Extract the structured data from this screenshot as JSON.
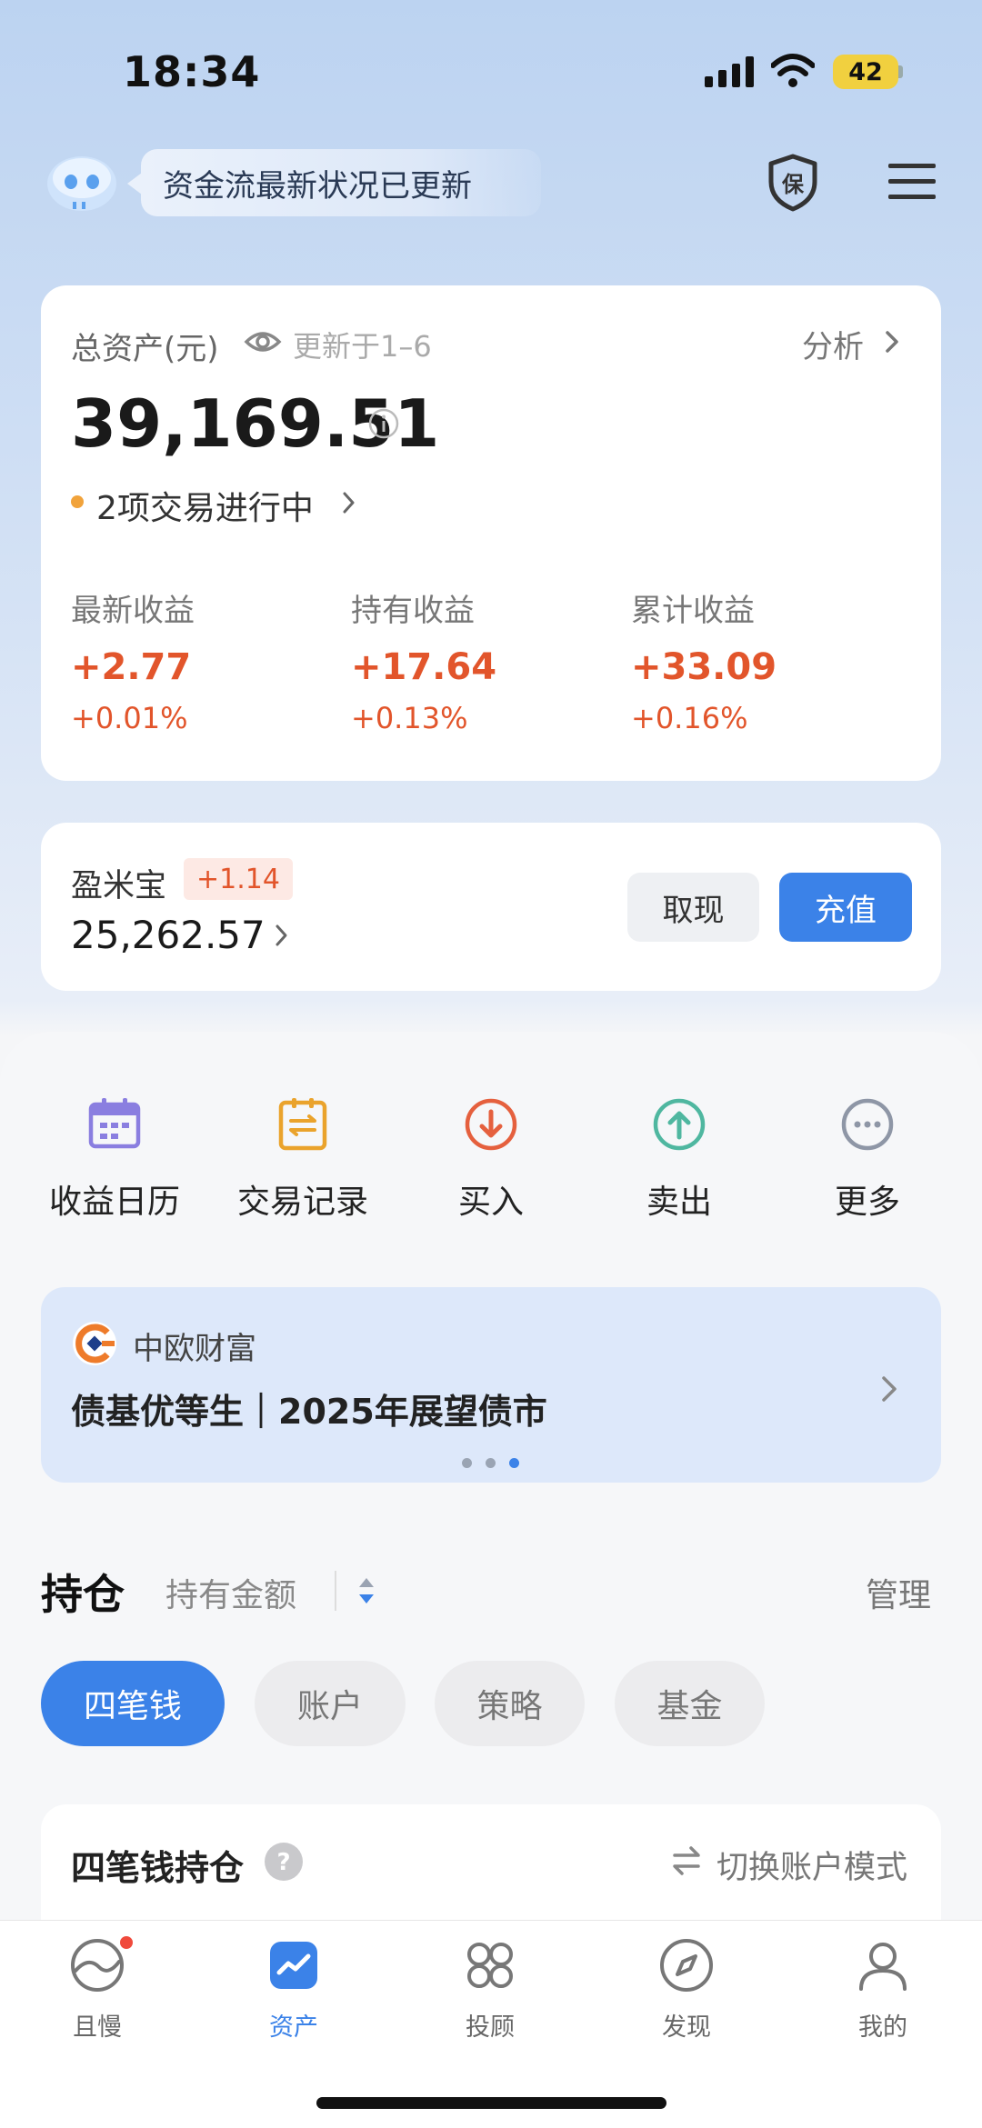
{
  "status_bar": {
    "time": "18:34",
    "battery": "42"
  },
  "header": {
    "notice": "资金流最新状况已更新"
  },
  "assets": {
    "title": "总资产(元)",
    "updated": "更新于1–6",
    "analyze": "分析",
    "total": "39,169.51",
    "pending": "2项交易进行中",
    "stats": [
      {
        "label": "最新收益",
        "value": "+2.77",
        "pct": "+0.01%"
      },
      {
        "label": "持有收益",
        "value": "+17.64",
        "pct": "+0.13%"
      },
      {
        "label": "累计收益",
        "value": "+33.09",
        "pct": "+0.16%"
      }
    ]
  },
  "yingmibao": {
    "name": "盈米宝",
    "badge": "+1.14",
    "amount": "25,262.57",
    "withdraw": "取现",
    "topup": "充值"
  },
  "quick_actions": [
    {
      "label": "收益日历",
      "icon": "calendar-icon"
    },
    {
      "label": "交易记录",
      "icon": "records-icon"
    },
    {
      "label": "买入",
      "icon": "buy-icon"
    },
    {
      "label": "卖出",
      "icon": "sell-icon"
    },
    {
      "label": "更多",
      "icon": "more-icon"
    }
  ],
  "banner": {
    "brand": "中欧财富",
    "title": "债基优等生｜2025年展望债市",
    "page_count": 3,
    "active_page": 3
  },
  "holdings": {
    "title": "持仓",
    "sort": "持有金额",
    "manage": "管理",
    "chips": [
      "四笔钱",
      "账户",
      "策略",
      "基金"
    ],
    "active_chip": 0,
    "card_title": "四笔钱持仓",
    "switch_mode": "切换账户模式"
  },
  "tabbar": [
    {
      "label": "且慢",
      "icon": "qieman-icon"
    },
    {
      "label": "资产",
      "icon": "assets-icon"
    },
    {
      "label": "投顾",
      "icon": "advisor-icon"
    },
    {
      "label": "发现",
      "icon": "discover-icon"
    },
    {
      "label": "我的",
      "icon": "profile-icon"
    }
  ],
  "colors": {
    "accent": "#3b82e8",
    "gain": "#e2552b",
    "banner_bg": "#dde8fa"
  }
}
